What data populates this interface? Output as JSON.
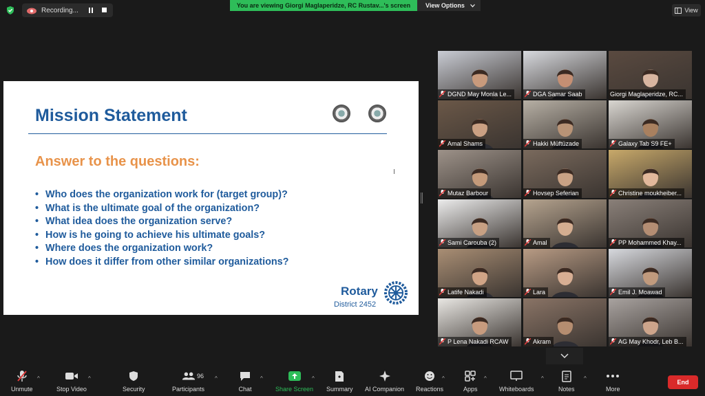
{
  "topbar": {
    "recording_label": "Recording...",
    "viewing_banner": "You are viewing Giorgi Maglaperidze, RC Rustav...'s screen",
    "view_options_label": "View Options",
    "view_label": "View"
  },
  "slide": {
    "title": "Mission Statement",
    "subhead": "Answer to the questions:",
    "bullets": [
      "Who does the organization work for (target group)?",
      "What is the ultimate goal of the organization?",
      "What idea does the organization serve?",
      "How is he going to achieve his ultimate goals?",
      "Where does the organization work?",
      "How does it differ from other similar organizations?"
    ],
    "brand": "Rotary",
    "district": "District 2452"
  },
  "participants": [
    {
      "name": "DGND May Monla Le...",
      "muted": true,
      "bg": "#c9ccd4",
      "skin": "#c89a7c"
    },
    {
      "name": "DGA Samar Saab",
      "muted": true,
      "bg": "#d7d9de",
      "skin": "#c58f73"
    },
    {
      "name": "Giorgi Maglaperidze, RC...",
      "muted": false,
      "bg": "#5a4a40",
      "skin": "#d8b5a0"
    },
    {
      "name": "Amal Shams",
      "muted": true,
      "bg": "#6b5848",
      "skin": "#caa083"
    },
    {
      "name": "Hakki Müftüzade",
      "muted": true,
      "bg": "#b7b0a5",
      "skin": "#b89376"
    },
    {
      "name": "Galaxy Tab S9 FE+",
      "muted": true,
      "bg": "#d9d6d1",
      "skin": "#a9805f"
    },
    {
      "name": "Mutaz Barbour",
      "muted": true,
      "bg": "#9d9289",
      "skin": "#c49a7a"
    },
    {
      "name": "Hovsep Seferian",
      "muted": true,
      "bg": "#7a6a5d",
      "skin": "#c9a285"
    },
    {
      "name": "Christine moukheiber...",
      "muted": true,
      "bg": "#c8a96a",
      "skin": "#e2b89b"
    },
    {
      "name": "Sami Carouba (2)",
      "muted": true,
      "bg": "#ececec",
      "skin": "#c7a083"
    },
    {
      "name": "Amal",
      "muted": true,
      "bg": "#b6a48f",
      "skin": "#d4ad90"
    },
    {
      "name": "PP Mohammed Khay...",
      "muted": true,
      "bg": "#8a8079",
      "skin": "#b48d73"
    },
    {
      "name": "Latife Nakadi",
      "muted": true,
      "bg": "#a98e74",
      "skin": "#d0a486"
    },
    {
      "name": "Lara",
      "muted": true,
      "bg": "#b89b84",
      "skin": "#d7ae93"
    },
    {
      "name": "Emil J. Moawad",
      "muted": true,
      "bg": "#d7d9de",
      "skin": "#c09a7d"
    },
    {
      "name": "P Lena Nakadi RCAW",
      "muted": true,
      "bg": "#e9e7e3",
      "skin": "#c79b7e"
    },
    {
      "name": "Akram",
      "muted": true,
      "bg": "#8a7466",
      "skin": "#b58d70"
    },
    {
      "name": "AG May Khodr, Leb B...",
      "muted": true,
      "bg": "#a9a3a0",
      "skin": "#cda48b"
    }
  ],
  "toolbar": {
    "unmute": "Unmute",
    "stop_video": "Stop Video",
    "security": "Security",
    "participants": "Participants",
    "participants_count": "96",
    "chat": "Chat",
    "share_screen": "Share Screen",
    "summary": "Summary",
    "ai_companion": "AI Companion",
    "reactions": "Reactions",
    "apps": "Apps",
    "whiteboards": "Whiteboards",
    "notes": "Notes",
    "more": "More",
    "end": "End"
  },
  "colors": {
    "banner_green": "#2ebd59",
    "title_blue": "#1f5b9c",
    "subhead_orange": "#e8934a",
    "end_red": "#d92a2a",
    "active_speaker": "#d8d83a"
  }
}
